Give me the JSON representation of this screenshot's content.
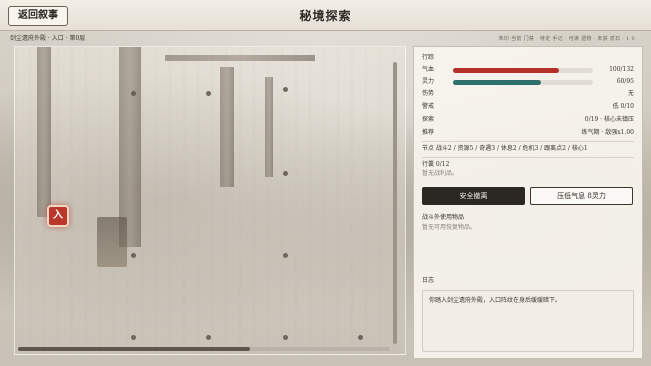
{
  "header": {
    "back_label": "返回叙事",
    "title": "秘境探索"
  },
  "location": {
    "breadcrumb": "剑尘遗府外殿 · 入口 · 第0层",
    "right_info": "朱印·当前  门禁 · 待定  手记 · 可读  遗物 · 未获  贰石 · 1 0"
  },
  "map": {
    "entry_label": "入"
  },
  "panel": {
    "section_label": "行踪",
    "hp": {
      "label": "气血",
      "value": "100/132",
      "ratio": 0.76,
      "color": "#b5302a"
    },
    "mp": {
      "label": "灵力",
      "value": "60/95",
      "ratio": 0.63,
      "color": "#2f6f6b"
    },
    "injury": {
      "label": "伤势",
      "value": "无"
    },
    "alert": {
      "label": "警戒",
      "value": "低 0/10"
    },
    "explore": {
      "label": "探索",
      "value": "0/19 · 核心未镇压"
    },
    "recommend": {
      "label": "推荐",
      "value": "练气期 · 敌强x1.00"
    },
    "nodes_summary": "节点 战斗2 / 资源5 / 奇遇3 / 休息2 / 危机3 / 跟离点2 / 核心1",
    "loot": {
      "label": "行囊 0/12",
      "note": "暂无战利品。"
    },
    "buttons": {
      "retreat": "安全撤离",
      "gather": "压低气息 8灵力"
    },
    "battle_items": {
      "label": "战斗外使用物品",
      "note": "暂无可用恢复物品。"
    },
    "log": {
      "label": "日志",
      "entries": [
        "你踏入剑尘遗府外殿，入口阵纹在身后缓缓暗下。"
      ]
    }
  }
}
